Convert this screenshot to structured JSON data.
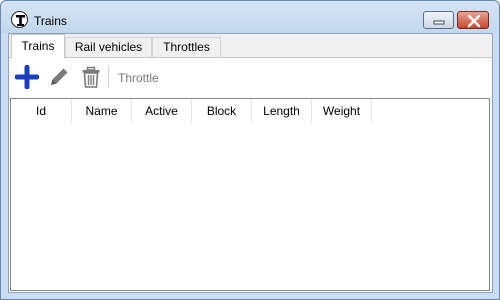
{
  "window": {
    "title": "Trains"
  },
  "title_buttons": {
    "minimize_icon": "minimize-icon",
    "close_icon": "close-icon"
  },
  "tabs": [
    {
      "label": "Trains",
      "active": true
    },
    {
      "label": "Rail vehicles",
      "active": false
    },
    {
      "label": "Throttles",
      "active": false
    }
  ],
  "toolbar": {
    "add_icon": "plus-icon",
    "edit_icon": "pencil-icon",
    "delete_icon": "trash-icon",
    "throttle_label": "Throttle",
    "colors": {
      "add": "#1a3fbf",
      "disabled": "#7a7a7a"
    }
  },
  "table": {
    "columns": [
      "Id",
      "Name",
      "Active",
      "Block",
      "Length",
      "Weight"
    ],
    "rows": []
  }
}
